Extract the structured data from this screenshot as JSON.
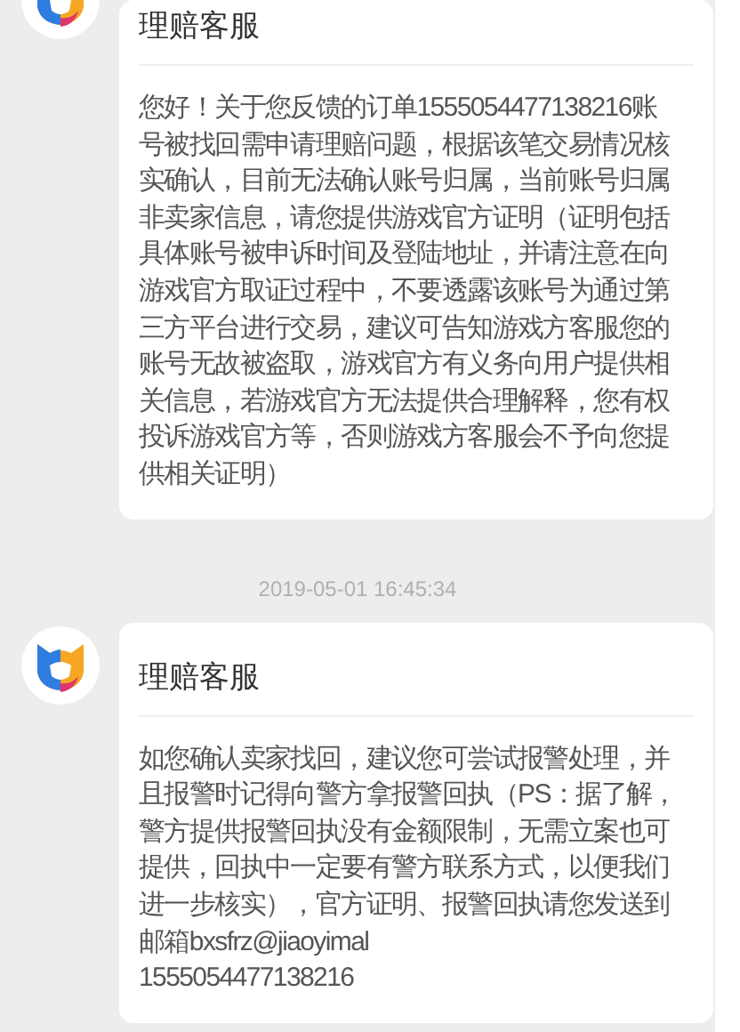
{
  "messages": [
    {
      "sender": "理赔客服",
      "lines": [
        "您好！关于您反馈的订单1555054477138216账",
        "号被找回需申请理赔问题，根据该笔交易情况核",
        "实确认，目前无法确认账号归属，当前账号归属",
        "非卖家信息，请您提供游戏官方证明（证明包括",
        "具体账号被申诉时间及登陆地址，并请注意在向",
        "游戏官方取证过程中，不要透露该账号为通过第",
        "三方平台进行交易，建议可告知游戏方客服您的",
        "账号无故被盗取，游戏官方有义务向用户提供相",
        "关信息，若游戏官方无法提供合理解释，您有权",
        "投诉游戏官方等，否则游戏方客服会不予向您提",
        "供相关证明）"
      ]
    },
    {
      "timestamp": "2019-05-01 16:45:34",
      "sender": "理赔客服",
      "lines": [
        "如您确认卖家找回，建议您可尝试报警处理，并",
        "且报警时记得向警方拿报警回执（PS：据了解，",
        "警方提供报警回执没有金额限制，无需立案也可",
        "提供，回执中一定要有警方联系方式，以便我们",
        "进一步核实），官方证明、报警回执请您发送到",
        "邮箱bxsfrz@jiaoyimal",
        "1555054477138216"
      ]
    }
  ]
}
